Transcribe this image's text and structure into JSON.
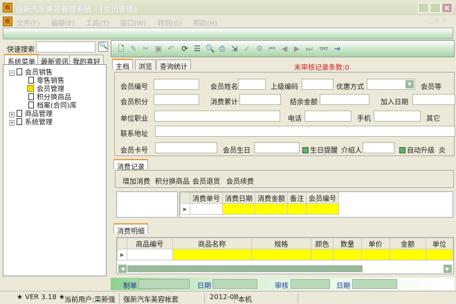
{
  "window": {
    "title": "强新汽车美容管理系统 - [会员管理]",
    "logo": "叹"
  },
  "menu": [
    "文件(F)",
    "编辑(E)",
    "工具(T)",
    "窗口(W)",
    "转到(G)",
    "帮助(H)"
  ],
  "left": {
    "search_label": "快速搜索",
    "search_value": "",
    "tabs": [
      "系统菜单",
      "最新资讯",
      "我的喜好"
    ],
    "tree": [
      {
        "label": "会员销售",
        "children": [
          "零售销售",
          "会员管理",
          "积分换商品",
          "档案(合同)库"
        ]
      },
      {
        "label": "商品管理"
      },
      {
        "label": "系统管理"
      }
    ]
  },
  "form_tabs": [
    "主档",
    "浏览",
    "查询统计"
  ],
  "unreviewed": "未审核记录条数:0",
  "fields": {
    "member_no": "会员编号",
    "member_name": "会员姓名",
    "parent_code": "上级编码",
    "discount": "优惠方式",
    "level": "会员等",
    "points": "会员积分",
    "total_spend": "消费累计",
    "balance": "结余金额",
    "join_date": "加入日期",
    "employer": "单位职业",
    "phone": "电话",
    "mobile": "手机",
    "other": "其它",
    "address": "联系地址",
    "card_no": "会员卡号",
    "birthday": "会员生日",
    "birthday_remind": "生日提醒",
    "referrer": "介绍人",
    "auto_upgrade": "自动升级",
    "more": "炎"
  },
  "records": {
    "tab": "消费记录",
    "actions": [
      "增加消费",
      "积分换商品",
      "会员退货",
      "会员续费"
    ],
    "columns": [
      "消费单号",
      "消费日期",
      "消费金额",
      "备注",
      "会员编号"
    ]
  },
  "details": {
    "tab": "消费明细",
    "columns": [
      "商品编号",
      "商品名称",
      "规格",
      "颜色",
      "数量",
      "单价",
      "金额",
      "单位"
    ]
  },
  "footer": {
    "maker": "制单",
    "date1": "日期",
    "reviewer": "审核",
    "date2": "日期"
  },
  "status": {
    "version": "★ VER 3.18 ★",
    "user": "当前用户:栾新强",
    "account": "强新汽车美容帐套",
    "period": "2012-08",
    "host": "本机"
  }
}
